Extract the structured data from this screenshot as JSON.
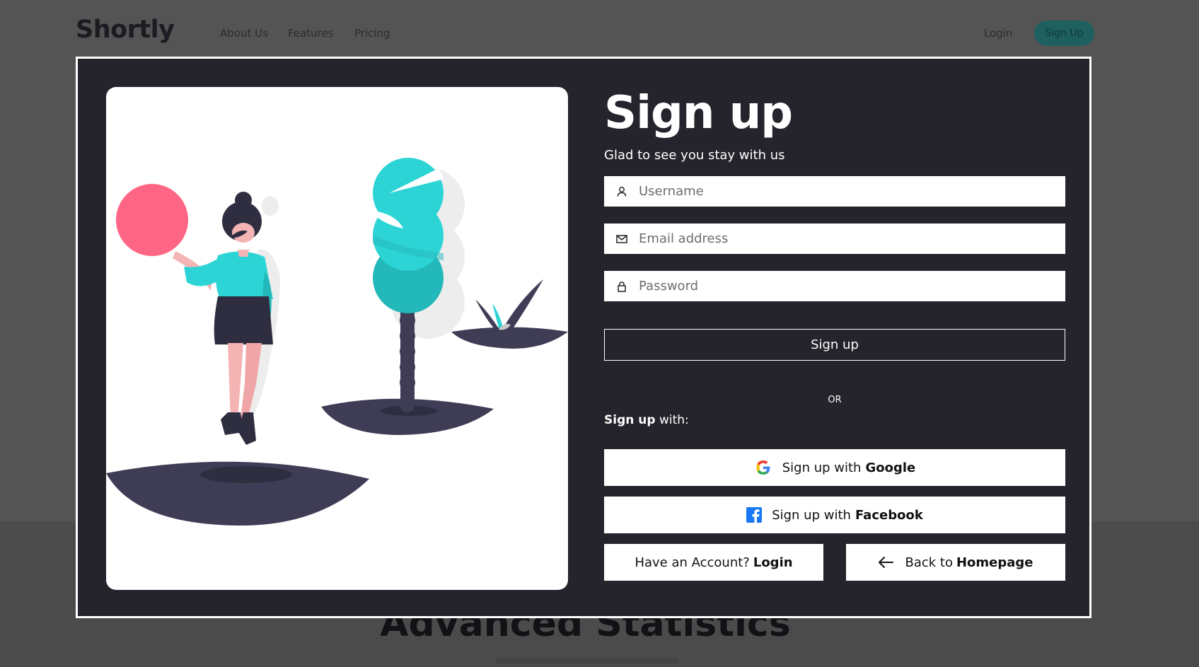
{
  "background_page": {
    "logo": "Shortly",
    "nav": [
      "About Us",
      "Features",
      "Pricing"
    ],
    "login": "Login",
    "signup": "Sign Up",
    "heading": "Advanced Statistics"
  },
  "modal": {
    "title": "Sign up",
    "subtitle": "Glad to see you stay with us",
    "fields": {
      "username": {
        "placeholder": "Username",
        "icon": "user-icon"
      },
      "email": {
        "placeholder": "Email address",
        "icon": "mail-icon"
      },
      "password": {
        "placeholder": "Password",
        "icon": "lock-icon"
      }
    },
    "submit_label": "Sign up",
    "or_label": "OR",
    "signup_with": {
      "bold": "Sign up",
      "rest": " with:"
    },
    "google": {
      "prefix": "Sign up with",
      "bold": "Google",
      "icon": "google-icon"
    },
    "facebook": {
      "prefix": "Sign up with",
      "bold": "Facebook",
      "icon": "facebook-icon"
    },
    "have_account": {
      "prefix": "Have an Account?",
      "bold": "Login"
    },
    "back": {
      "prefix": "Back to",
      "bold": "Homepage",
      "icon": "arrow-left-icon"
    }
  },
  "colors": {
    "modal_bg": "#25232b",
    "accent_teal": "#2dd4d6",
    "accent_pink": "#ff6584",
    "dark_figure": "#3f3d56",
    "facebook_blue": "#1877f2"
  }
}
